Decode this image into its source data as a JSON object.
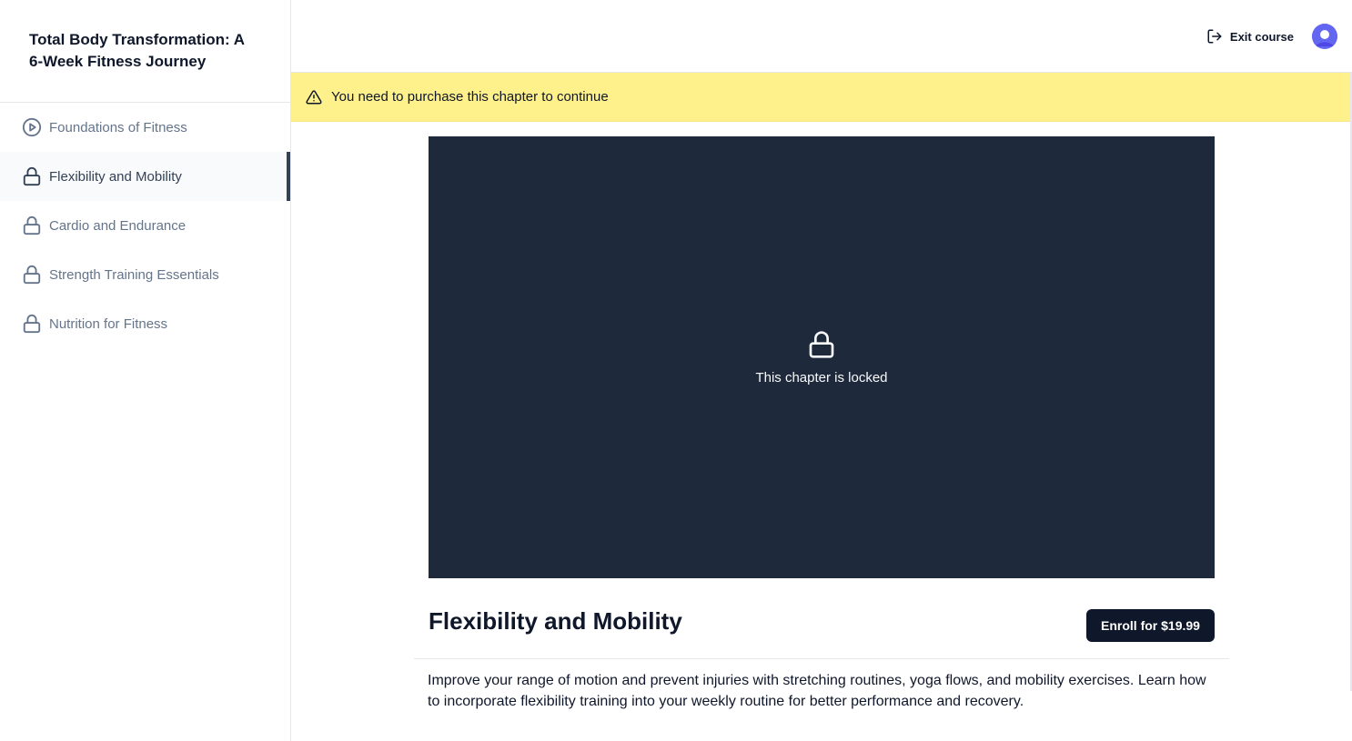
{
  "course": {
    "title": "Total Body Transformation: A 6-Week Fitness Journey"
  },
  "chapters": [
    {
      "label": "Foundations of Fitness",
      "icon": "play-circle-icon",
      "state": "unlocked"
    },
    {
      "label": "Flexibility and Mobility",
      "icon": "lock-icon",
      "state": "active-locked"
    },
    {
      "label": "Cardio and Endurance",
      "icon": "lock-icon",
      "state": "locked"
    },
    {
      "label": "Strength Training Essentials",
      "icon": "lock-icon",
      "state": "locked"
    },
    {
      "label": "Nutrition for Fitness",
      "icon": "lock-icon",
      "state": "locked"
    }
  ],
  "topbar": {
    "exit_label": "Exit course",
    "exit_icon": "log-out-icon",
    "avatar_color": "#6366f1"
  },
  "banner": {
    "icon": "alert-triangle-icon",
    "text": "You need to purchase this chapter to continue",
    "color": "#fef08a"
  },
  "player": {
    "locked_text": "This chapter is locked",
    "icon": "lock-icon",
    "background": "#1e293b"
  },
  "chapter": {
    "title": "Flexibility and Mobility",
    "enroll_label": "Enroll for $19.99",
    "description": "Improve your range of motion and prevent injuries with stretching routines, yoga flows, and mobility exercises. Learn how to incorporate flexibility training into your weekly routine for better performance and recovery."
  }
}
